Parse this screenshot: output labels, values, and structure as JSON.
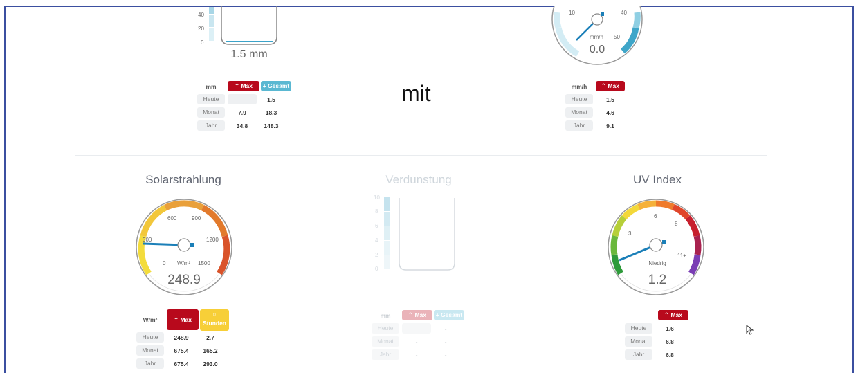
{
  "rain_top": {
    "axis_ticks": [
      "40",
      "20",
      "0"
    ],
    "value": "1.5 mm",
    "table": {
      "unit": "mm",
      "max_label": "Max",
      "total_label": "Gesamt",
      "rows": [
        {
          "label": "Heute",
          "max": "",
          "total": "1.5"
        },
        {
          "label": "Monat",
          "max": "7.9",
          "total": "18.3"
        },
        {
          "label": "Jahr",
          "max": "34.8",
          "total": "148.3"
        }
      ]
    }
  },
  "center_word": "mit",
  "rain_rate": {
    "ticks": [
      "10",
      "40",
      "50"
    ],
    "unit": "mm/h",
    "value": "0.0",
    "table": {
      "unit": "mm/h",
      "max_label": "Max",
      "rows": [
        {
          "label": "Heute",
          "max": "1.5"
        },
        {
          "label": "Monat",
          "max": "4.6"
        },
        {
          "label": "Jahr",
          "max": "9.1"
        }
      ]
    }
  },
  "solar": {
    "title": "Solarstrahlung",
    "ticks": [
      "0",
      "300",
      "600",
      "900",
      "1200",
      "1500"
    ],
    "unit": "W/m²",
    "value": "248.9",
    "gauge_fraction": 0.166,
    "table": {
      "unit": "W/m²",
      "max_label": "Max",
      "hours_label": "Stunden",
      "rows": [
        {
          "label": "Heute",
          "max": "248.9",
          "hours": "2.7"
        },
        {
          "label": "Monat",
          "max": "675.4",
          "hours": "165.2"
        },
        {
          "label": "Jahr",
          "max": "675.4",
          "hours": "293.0"
        }
      ]
    }
  },
  "evap": {
    "title": "Verdunstung",
    "axis_ticks": [
      "10",
      "8",
      "6",
      "4",
      "2",
      "0"
    ],
    "table": {
      "unit": "mm",
      "max_label": "Max",
      "total_label": "Gesamt",
      "rows": [
        {
          "label": "Heute",
          "max": "",
          "total": "-"
        },
        {
          "label": "Monat",
          "max": "-",
          "total": "-"
        },
        {
          "label": "Jahr",
          "max": "-",
          "total": "-"
        }
      ]
    }
  },
  "uv": {
    "title": "UV Index",
    "ticks": [
      "3",
      "6",
      "8",
      "11+"
    ],
    "level_text": "Niedrig",
    "value": "1.2",
    "table": {
      "max_label": "Max",
      "rows": [
        {
          "label": "Heute",
          "max": "1.6"
        },
        {
          "label": "Monat",
          "max": "6.8"
        },
        {
          "label": "Jahr",
          "max": "6.8"
        }
      ]
    }
  },
  "colors": {
    "frame": "#3b4fa0",
    "max_red": "#b8091c",
    "total_blue": "#5ab8d2",
    "hours_yellow": "#f7cf38",
    "needle_blue": "#1b7fb8"
  }
}
